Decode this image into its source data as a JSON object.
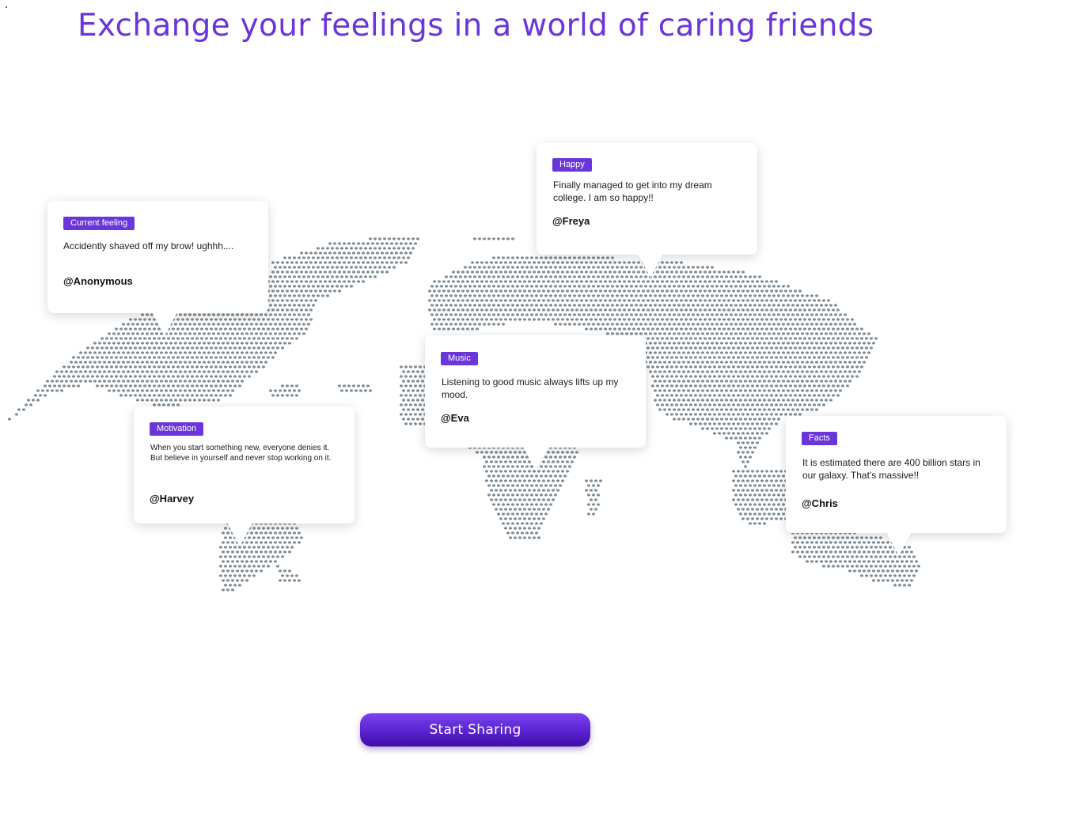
{
  "headline": "Exchange your feelings in a world of caring friends",
  "colors": {
    "accent": "#6a35d9",
    "map_dots": "#7d8a93",
    "card_bg": "#ffffff"
  },
  "cards": [
    {
      "tag": "Current feeling",
      "text": "Accidently shaved off my brow! ughhh....",
      "author": "@Anonymous"
    },
    {
      "tag": "Happy",
      "text": "Finally managed to get into my dream college. I am so happy!!",
      "author": "@Freya"
    },
    {
      "tag": "Music",
      "text": "Listening to good music always lifts up my mood.",
      "author": "@Eva"
    },
    {
      "tag": "Motivation",
      "text": "When you start something new, everyone denies it.  But believe in yourself and never stop working on it.",
      "author": "@Harvey"
    },
    {
      "tag": "Facts",
      "text": "It is estimated there are 400 billion stars in our galaxy. That's massive!!",
      "author": "@Chris"
    }
  ],
  "cta": {
    "label": "Start Sharing"
  },
  "map": {
    "name": "world-map-dots"
  }
}
